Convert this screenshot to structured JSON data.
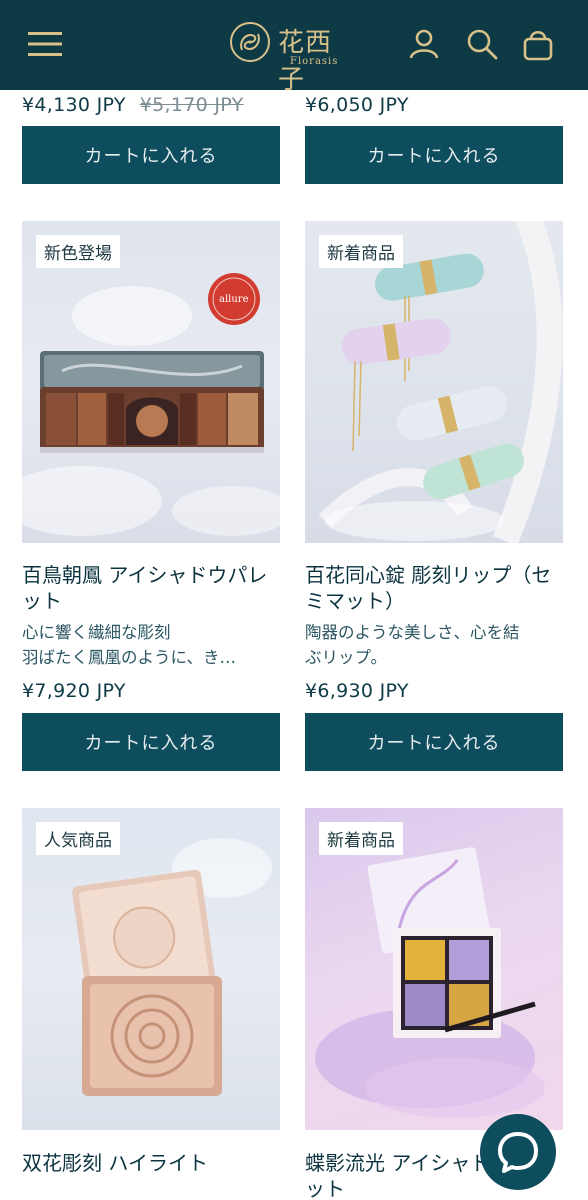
{
  "header": {
    "brand_cn": "花西子",
    "brand_en": "Florasis",
    "icons": [
      "menu-icon",
      "account-icon",
      "search-icon",
      "bag-icon"
    ]
  },
  "top_row": {
    "left": {
      "price": "¥4,130 JPY",
      "old_price": "¥5,170 JPY",
      "cart_label": "カートに入れる"
    },
    "right": {
      "price": "¥6,050 JPY",
      "cart_label": "カートに入れる"
    }
  },
  "products": [
    {
      "badge": "新色登場",
      "title": "百鳥朝鳳 アイシャドウパレット",
      "desc_line1": "心に響く繊細な彫刻",
      "desc_line2": "羽ばたく鳳凰のように、き…",
      "price": "¥7,920 JPY",
      "cart_label": "カートに入れる",
      "award_text": "allure"
    },
    {
      "badge": "新着商品",
      "title": "百花同心錠 彫刻リップ（セミマット）",
      "desc_line1": "陶器のような美しさ、心を結",
      "desc_line2": "ぶリップ。",
      "price": "¥6,930 JPY",
      "cart_label": "カートに入れる"
    },
    {
      "badge": "人気商品",
      "title": "双花彫刻 ハイライト"
    },
    {
      "badge": "新着商品",
      "title": "蝶影流光 アイシャドウパレット"
    }
  ],
  "colors": {
    "header_bg": "#0d3a45",
    "accent_gold": "#d8c08a",
    "button_bg": "#0e4d5d"
  }
}
